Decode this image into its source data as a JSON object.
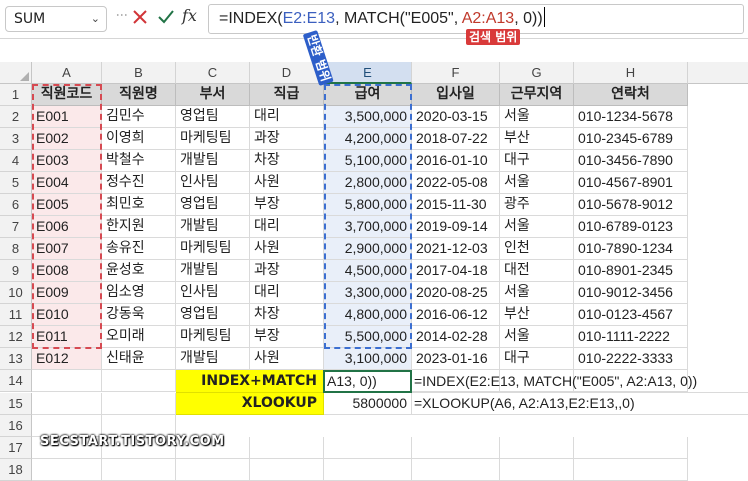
{
  "formula_bar": {
    "name_box": "SUM",
    "fx_label": "fx",
    "formula_parts": [
      "=INDEX(",
      "E2:E13",
      ", MATCH(\"E005\", ",
      "A2:A13",
      ", 0))"
    ]
  },
  "annotations": {
    "search_range": "검색 범위",
    "return_range": "반환 범위"
  },
  "watermark": "SECSTART.TISTORY.COM",
  "columns": [
    "A",
    "B",
    "C",
    "D",
    "E",
    "F",
    "G",
    "H"
  ],
  "rows": [
    "1",
    "2",
    "3",
    "4",
    "5",
    "6",
    "7",
    "8",
    "9",
    "10",
    "11",
    "12",
    "13",
    "14",
    "15",
    "16",
    "17",
    "18"
  ],
  "table": {
    "headers": [
      "직원코드",
      "직원명",
      "부서",
      "직급",
      "급여",
      "입사일",
      "근무지역",
      "연락처"
    ],
    "rows": [
      [
        "E001",
        "김민수",
        "영업팀",
        "대리",
        "3,500,000",
        "2020-03-15",
        "서울",
        "010-1234-5678"
      ],
      [
        "E002",
        "이영희",
        "마케팅팀",
        "과장",
        "4,200,000",
        "2018-07-22",
        "부산",
        "010-2345-6789"
      ],
      [
        "E003",
        "박철수",
        "개발팀",
        "차장",
        "5,100,000",
        "2016-01-10",
        "대구",
        "010-3456-7890"
      ],
      [
        "E004",
        "정수진",
        "인사팀",
        "사원",
        "2,800,000",
        "2022-05-08",
        "서울",
        "010-4567-8901"
      ],
      [
        "E005",
        "최민호",
        "영업팀",
        "부장",
        "5,800,000",
        "2015-11-30",
        "광주",
        "010-5678-9012"
      ],
      [
        "E006",
        "한지원",
        "개발팀",
        "대리",
        "3,700,000",
        "2019-09-14",
        "서울",
        "010-6789-0123"
      ],
      [
        "E007",
        "송유진",
        "마케팅팀",
        "사원",
        "2,900,000",
        "2021-12-03",
        "인천",
        "010-7890-1234"
      ],
      [
        "E008",
        "윤성호",
        "개발팀",
        "과장",
        "4,500,000",
        "2017-04-18",
        "대전",
        "010-8901-2345"
      ],
      [
        "E009",
        "임소영",
        "인사팀",
        "대리",
        "3,300,000",
        "2020-08-25",
        "서울",
        "010-9012-3456"
      ],
      [
        "E010",
        "강동욱",
        "영업팀",
        "차장",
        "4,800,000",
        "2016-06-12",
        "부산",
        "010-0123-4567"
      ],
      [
        "E011",
        "오미래",
        "마케팅팀",
        "부장",
        "5,500,000",
        "2014-02-28",
        "서울",
        "010-1111-2222"
      ],
      [
        "E012",
        "신태윤",
        "개발팀",
        "사원",
        "3,100,000",
        "2023-01-16",
        "대구",
        "010-2222-3333"
      ]
    ]
  },
  "lookup": {
    "index_match_label": "INDEX+MATCH",
    "index_match_cell": "A13, 0))",
    "index_match_formula": "=INDEX(E2:E13, MATCH(\"E005\", A2:A13, 0))",
    "xlookup_label": "XLOOKUP",
    "xlookup_value": "5800000",
    "xlookup_formula": "=XLOOKUP(A6, A2:A13,E2:E13,,0)"
  },
  "colors": {
    "search_range": "#d64a52",
    "return_range": "#3c6fd1",
    "label_fill": "#ffff00",
    "header_fill": "#d9d9d9"
  }
}
